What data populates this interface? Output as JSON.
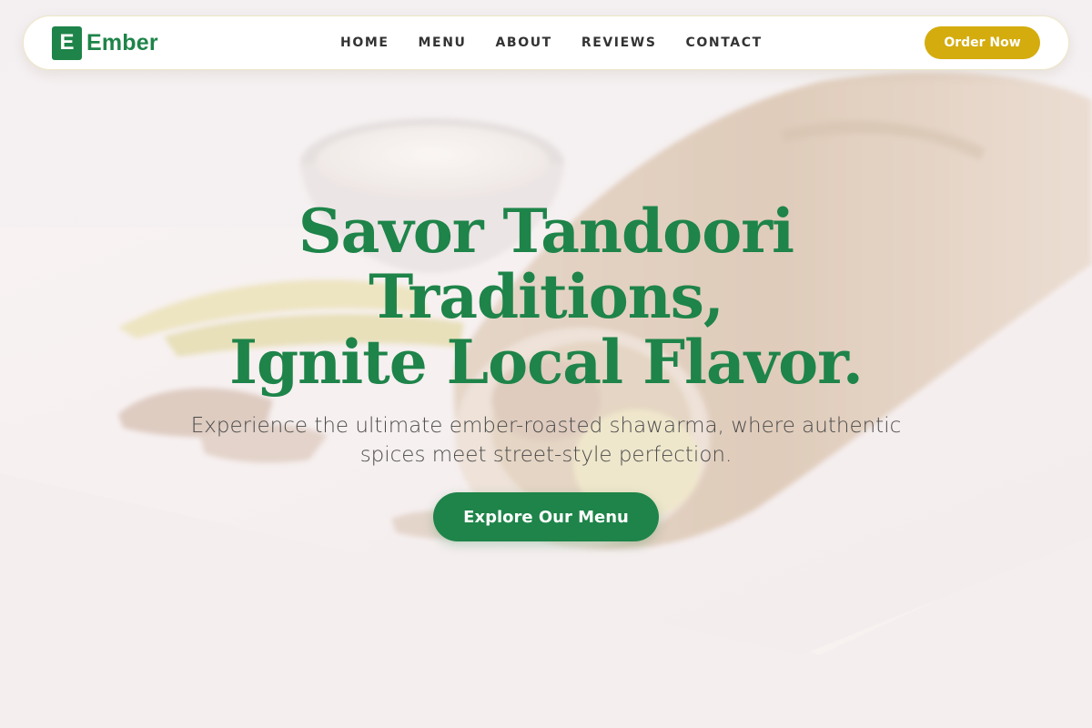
{
  "brand": {
    "mark": "E",
    "name": "Ember"
  },
  "nav": {
    "links": [
      {
        "label": "HOME"
      },
      {
        "label": "MENU"
      },
      {
        "label": "ABOUT"
      },
      {
        "label": "REVIEWS"
      },
      {
        "label": "CONTACT"
      }
    ],
    "order_label": "Order Now"
  },
  "hero": {
    "title_lines": [
      "Savor Tandoori",
      "Traditions,",
      "Ignite Local Flavor."
    ],
    "subtitle": "Experience the ultimate ember-roasted shawarma, where authentic spices meet street-style perfection.",
    "cta_label": "Explore Our Menu",
    "background_image": "shawarma-wrap-photo"
  },
  "colors": {
    "brand_green": "#1e8449",
    "accent_gold": "#d4ac0d",
    "nav_text": "#333333",
    "body_text": "#4a4a4a"
  }
}
